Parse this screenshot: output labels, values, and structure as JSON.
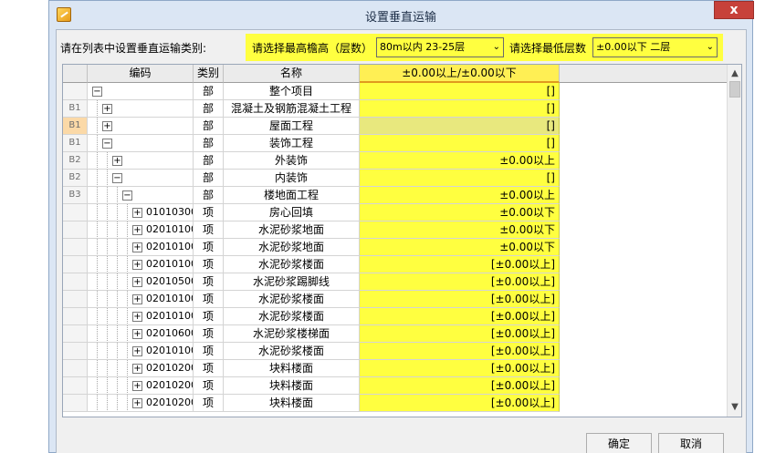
{
  "window": {
    "title": "设置垂直运输",
    "close_label": "x"
  },
  "filters": {
    "category_label": "请在列表中设置垂直运输类别:",
    "eave_label": "请选择最高檐高（层数）",
    "eave_value": "80m以内 23-25层",
    "floor_label": "请选择最低层数",
    "floor_value": "±0.00以下 二层"
  },
  "table": {
    "headers": {
      "level": "",
      "code": "编码",
      "type": "类别",
      "name": "名称",
      "value": "±0.00以上/±0.00以下"
    },
    "rows": [
      {
        "level": "",
        "depth": 0,
        "expander": "−",
        "code": "",
        "type": "部",
        "name": "整个项目",
        "value": "[]"
      },
      {
        "level": "B1",
        "depth": 1,
        "expander": "+",
        "code": "",
        "type": "部",
        "name": "混凝土及钢筋混凝土工程",
        "value": "[]"
      },
      {
        "level": "B1",
        "depth": 1,
        "expander": "+",
        "code": "",
        "type": "部",
        "name": "屋面工程",
        "value": "[]",
        "selected": true
      },
      {
        "level": "B1",
        "depth": 1,
        "expander": "−",
        "code": "",
        "type": "部",
        "name": "装饰工程",
        "value": "[]"
      },
      {
        "level": "B2",
        "depth": 2,
        "expander": "+",
        "code": "",
        "type": "部",
        "name": "外装饰",
        "value": "±0.00以上"
      },
      {
        "level": "B2",
        "depth": 2,
        "expander": "−",
        "code": "",
        "type": "部",
        "name": "内装饰",
        "value": "[]"
      },
      {
        "level": "B3",
        "depth": 3,
        "expander": "−",
        "code": "",
        "type": "部",
        "name": "楼地面工程",
        "value": "±0.00以上"
      },
      {
        "level": "",
        "depth": 4,
        "expander": "+",
        "code": "01010300",
        "type": "项",
        "name": "房心回填",
        "value": "±0.00以下"
      },
      {
        "level": "",
        "depth": 4,
        "expander": "+",
        "code": "02010100",
        "type": "项",
        "name": "水泥砂浆地面",
        "value": "±0.00以下"
      },
      {
        "level": "",
        "depth": 4,
        "expander": "+",
        "code": "02010100",
        "type": "项",
        "name": "水泥砂浆地面",
        "value": "±0.00以下"
      },
      {
        "level": "",
        "depth": 4,
        "expander": "+",
        "code": "02010100",
        "type": "项",
        "name": "水泥砂浆楼面",
        "value": "[±0.00以上]"
      },
      {
        "level": "",
        "depth": 4,
        "expander": "+",
        "code": "02010500",
        "type": "项",
        "name": "水泥砂浆踢脚线",
        "value": "[±0.00以上]"
      },
      {
        "level": "",
        "depth": 4,
        "expander": "+",
        "code": "02010100",
        "type": "项",
        "name": "水泥砂浆楼面",
        "value": "[±0.00以上]"
      },
      {
        "level": "",
        "depth": 4,
        "expander": "+",
        "code": "02010100",
        "type": "项",
        "name": "水泥砂浆楼面",
        "value": "[±0.00以上]"
      },
      {
        "level": "",
        "depth": 4,
        "expander": "+",
        "code": "02010600",
        "type": "项",
        "name": "水泥砂浆楼梯面",
        "value": "[±0.00以上]"
      },
      {
        "level": "",
        "depth": 4,
        "expander": "+",
        "code": "02010100",
        "type": "项",
        "name": "水泥砂浆楼面",
        "value": "[±0.00以上]"
      },
      {
        "level": "",
        "depth": 4,
        "expander": "+",
        "code": "02010200",
        "type": "项",
        "name": "块料楼面",
        "value": "[±0.00以上]"
      },
      {
        "level": "",
        "depth": 4,
        "expander": "+",
        "code": "02010200",
        "type": "项",
        "name": "块料楼面",
        "value": "[±0.00以上]"
      },
      {
        "level": "",
        "depth": 4,
        "expander": "+",
        "code": "02010200",
        "type": "项",
        "name": "块料楼面",
        "value": "[±0.00以上]"
      }
    ]
  },
  "buttons": {
    "ok": "确定",
    "cancel": "取消"
  },
  "colors": {
    "highlight": "#ffff40",
    "header_accent": "#e09a1e",
    "close": "#c7413a"
  }
}
